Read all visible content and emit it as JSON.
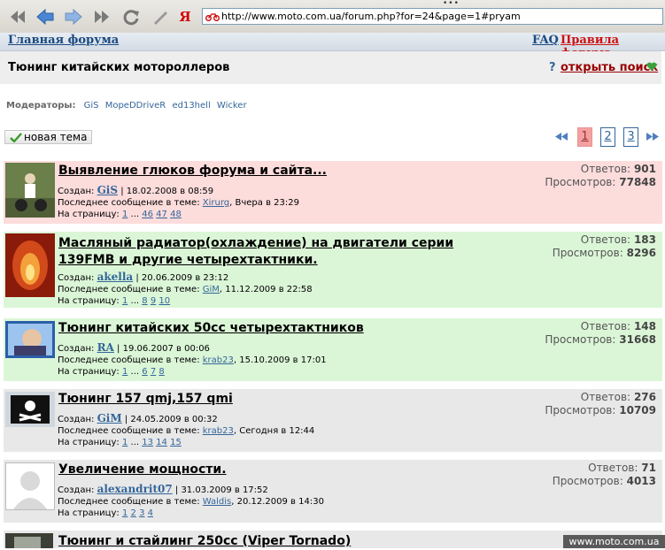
{
  "browser": {
    "url": "http://www.moto.com.ua/forum.php?for=24&page=1#pryam",
    "yandex_label": "Я"
  },
  "header": {
    "home_link": "Главная форума",
    "faq_link": "FAQ",
    "rules_link": "Правила форума"
  },
  "forum": {
    "title": "Тюнинг китайских мотороллеров",
    "help_mark": "?",
    "search_link": "открыть поиск"
  },
  "moderators": {
    "label": "Модераторы:",
    "names": [
      "GiS",
      "MopeDDriveR",
      "ed13hell",
      "Wicker"
    ]
  },
  "new_topic_label": "новая тема",
  "pagination": {
    "pages": [
      "1",
      "2",
      "3"
    ],
    "current": "1"
  },
  "labels": {
    "created": "Создан:",
    "last_post": "Последнее сообщение в теме:",
    "on_page": "На страницу:",
    "replies": "Ответов:",
    "views": "Просмотров:"
  },
  "topics": [
    {
      "title": "Выявление глюков форума и сайта...",
      "author": "GiS",
      "created": "| 18.02.2008 в 08:59",
      "last_user": "Xirurg",
      "last_time": ", Вчера в 23:29",
      "pages": [
        "1",
        "...",
        "46",
        "47",
        "48"
      ],
      "replies": "901",
      "views": "77848",
      "color": "red"
    },
    {
      "title": "Масляный радиатор(охлаждение) на двигатели серии 139FMB и другие четырехтактники.",
      "author": "akella",
      "created": "| 20.06.2009 в 23:12",
      "last_user": "GiM",
      "last_time": ", 11.12.2009 в 22:58",
      "pages": [
        "1",
        "...",
        "8",
        "9",
        "10"
      ],
      "replies": "183",
      "views": "8296",
      "color": "green"
    },
    {
      "title": "Тюнинг китайских 50сс четырехтактников",
      "author": "RA",
      "created": "| 19.06.2007 в 00:06",
      "last_user": "krab23",
      "last_time": ", 15.10.2009 в 17:01",
      "pages": [
        "1",
        "...",
        "6",
        "7",
        "8"
      ],
      "replies": "148",
      "views": "31668",
      "color": "green"
    },
    {
      "title": "Тюнинг 157 qmj,157 qmi",
      "author": "GiM",
      "created": "| 24.05.2009 в 00:32",
      "last_user": "krab23",
      "last_time": ", Сегодня в 12:44",
      "pages": [
        "1",
        "...",
        "13",
        "14",
        "15"
      ],
      "replies": "276",
      "views": "10709",
      "color": "gray"
    },
    {
      "title": "Увеличение мощности.",
      "author": "alexandrit07",
      "created": "| 31.03.2009 в 17:52",
      "last_user": "Waldis",
      "last_time": ", 20.12.2009 в 14:30",
      "pages": [
        "1",
        "2",
        "3",
        "4"
      ],
      "replies": "71",
      "views": "4013",
      "color": "gray"
    },
    {
      "title": "Тюнинг и стайлинг 250сс (Viper Tornado)",
      "color": "gray"
    }
  ],
  "watermark": "www.moto.com.ua"
}
